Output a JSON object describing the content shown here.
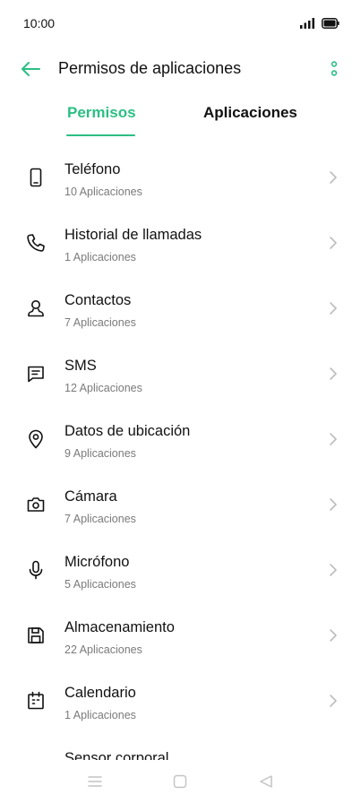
{
  "status_bar": {
    "time": "10:00"
  },
  "app_bar": {
    "title": "Permisos de aplicaciones"
  },
  "tabs": [
    {
      "label": "Permisos",
      "active": true
    },
    {
      "label": "Aplicaciones",
      "active": false
    }
  ],
  "accent_color": "#2bbf83",
  "permissions": [
    {
      "title": "Teléfono",
      "subtitle": "10 Aplicaciones",
      "icon": "phone-icon"
    },
    {
      "title": "Historial de llamadas",
      "subtitle": "1 Aplicaciones",
      "icon": "call-log-icon"
    },
    {
      "title": "Contactos",
      "subtitle": "7 Aplicaciones",
      "icon": "contacts-icon"
    },
    {
      "title": "SMS",
      "subtitle": "12 Aplicaciones",
      "icon": "sms-icon"
    },
    {
      "title": "Datos de ubicación",
      "subtitle": "9 Aplicaciones",
      "icon": "location-icon"
    },
    {
      "title": "Cámara",
      "subtitle": "7 Aplicaciones",
      "icon": "camera-icon"
    },
    {
      "title": "Micrófono",
      "subtitle": "5 Aplicaciones",
      "icon": "microphone-icon"
    },
    {
      "title": "Almacenamiento",
      "subtitle": "22 Aplicaciones",
      "icon": "storage-icon"
    },
    {
      "title": "Calendario",
      "subtitle": "1 Aplicaciones",
      "icon": "calendar-icon"
    },
    {
      "title": "Sensor corporal",
      "subtitle": "",
      "icon": "body-sensor-icon"
    }
  ]
}
